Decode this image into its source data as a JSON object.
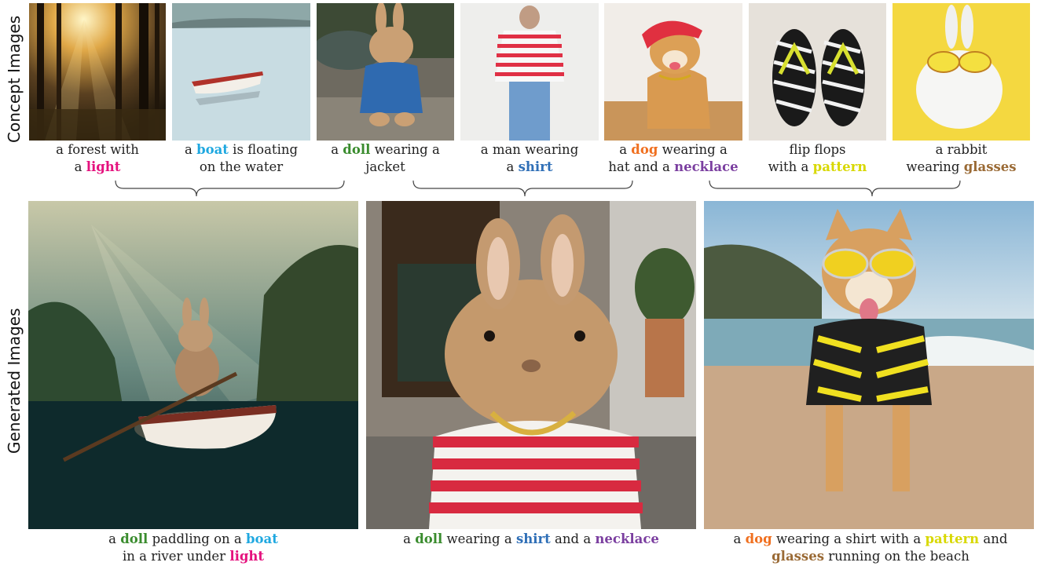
{
  "row_labels": {
    "concept": "Concept Images",
    "generated": "Generated Images"
  },
  "concepts": [
    {
      "line1_pre": "a forest with",
      "line1_kw": "",
      "line1_post": "",
      "line2_pre": "a ",
      "line2_kw": "light",
      "line2_post": "",
      "color": "#e5127e"
    },
    {
      "line1_pre": "a ",
      "line1_kw": "boat",
      "line1_post": " is floating",
      "line2_pre": "on the water",
      "line2_kw": "",
      "line2_post": "",
      "color": "#1fa8e0"
    },
    {
      "line1_pre": "a ",
      "line1_kw": "doll",
      "line1_post": " wearing a",
      "line2_pre": "jacket",
      "line2_kw": "",
      "line2_post": "",
      "color": "#3a8c2e"
    },
    {
      "line1_pre": "a man wearing",
      "line1_kw": "",
      "line1_post": "",
      "line2_pre": "a ",
      "line2_kw": "shirt",
      "line2_post": "",
      "color": "#2f6fb7"
    },
    {
      "line1_pre": "a ",
      "line1_kw": "dog",
      "line1_post": " wearing a",
      "line2_pre": "hat and a ",
      "line2_kw": "necklace",
      "line2_post": "",
      "color": "#f07020"
    },
    {
      "line1_pre": "flip flops",
      "line1_kw": "",
      "line1_post": "",
      "line2_pre": "with a ",
      "line2_kw": "pattern",
      "line2_post": "",
      "color": "#d8d800"
    },
    {
      "line1_pre": "a rabbit",
      "line1_kw": "",
      "line1_post": "",
      "line2_pre": "wearing ",
      "line2_kw": "glasses",
      "line2_post": "",
      "color": "#9a6a35"
    }
  ],
  "generated": [
    {
      "line1_a": "a ",
      "line1_k1": "doll",
      "line1_b": " paddling on a ",
      "line1_k2": "boat",
      "line2_a": "in a river under ",
      "line2_k1": "light"
    },
    {
      "line1_a": "a ",
      "line1_k1": "doll",
      "line1_b": " wearing a ",
      "line1_k2": "shirt",
      "line1_c": " and a ",
      "line1_k3": "necklace"
    },
    {
      "line1_a": "a ",
      "line1_k1": "dog",
      "line1_b": " wearing a shirt with a ",
      "line1_k2": "pattern",
      "line1_c": " and",
      "line2_k1": "glasses",
      "line2_a": " running on the beach"
    }
  ]
}
